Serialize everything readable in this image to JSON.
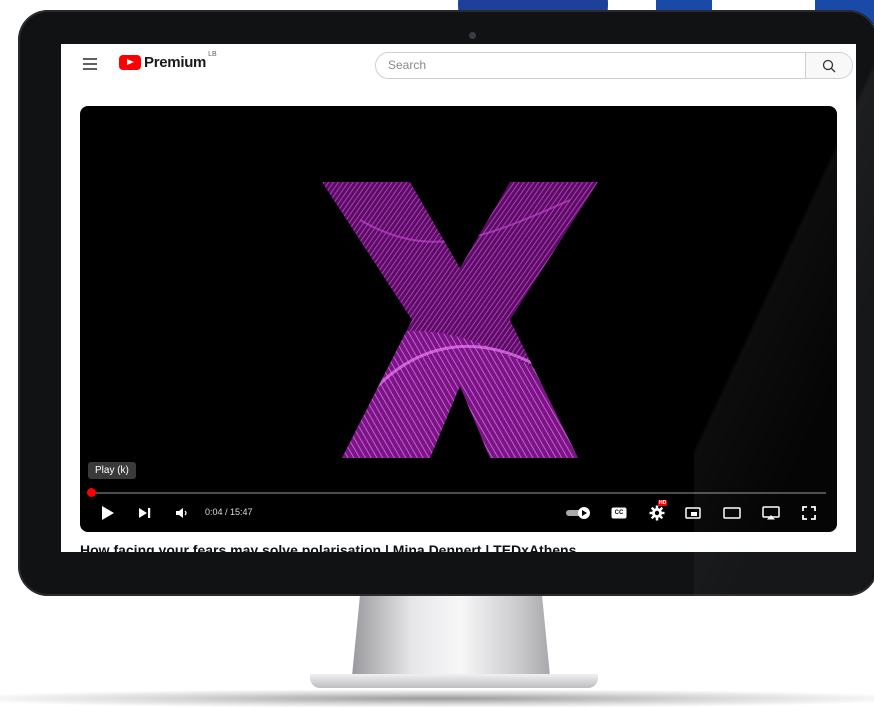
{
  "header": {
    "logo_text": "Premium",
    "logo_superscript": "LB",
    "search_placeholder": "Search"
  },
  "player": {
    "tooltip": "Play (k)",
    "current_time": "0:04",
    "duration": "15:47",
    "time_display": "0:04 / 15:47",
    "progress_fraction": 0.004,
    "hd_badge": "HD",
    "cc_label": "CC"
  },
  "video": {
    "title": "How facing your fears may solve polarisation | Mina Dennert | TEDxAthens"
  },
  "colors": {
    "brand_red": "#ff0000",
    "bezel": "#111214",
    "tedx_magenta": "#d03cd9"
  },
  "icons": [
    "menu-icon",
    "youtube-logo-icon",
    "search-icon",
    "play-icon",
    "next-icon",
    "volume-icon",
    "autoplay-toggle-icon",
    "captions-icon",
    "settings-icon",
    "miniplayer-icon",
    "theater-mode-icon",
    "cast-icon",
    "fullscreen-icon"
  ]
}
